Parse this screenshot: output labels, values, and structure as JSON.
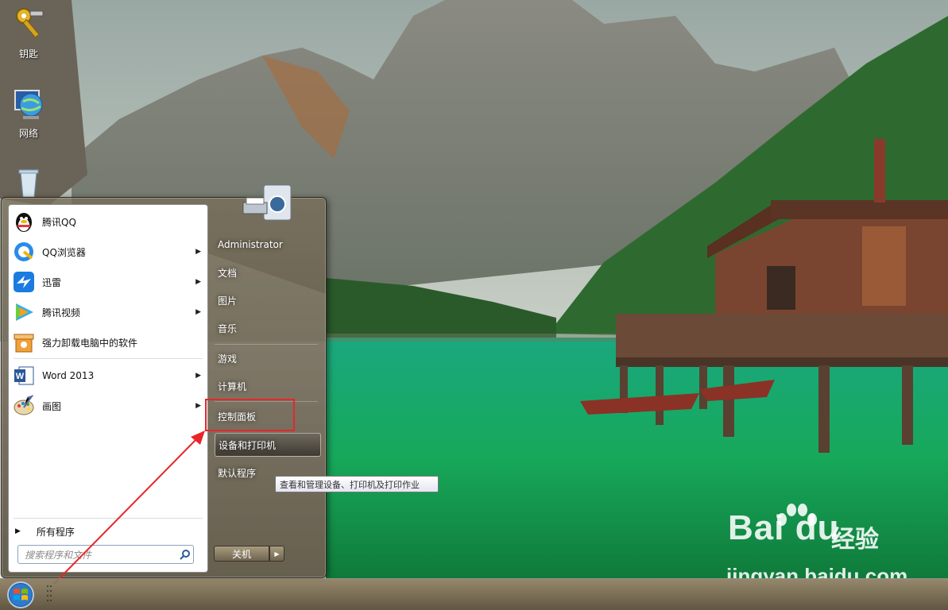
{
  "desktop": {
    "icons": [
      {
        "label": "钥匙",
        "icon": "key-icon"
      },
      {
        "label": "网络",
        "icon": "network-globe-icon"
      },
      {
        "label": "",
        "icon": "recycle-bin-icon"
      }
    ]
  },
  "start_menu": {
    "pinned_programs": [
      {
        "label": "腾讯QQ",
        "icon": "qq-penguin-icon",
        "has_submenu": false
      },
      {
        "label": "QQ浏览器",
        "icon": "qq-browser-icon",
        "has_submenu": true
      },
      {
        "label": "迅雷",
        "icon": "xunlei-bird-icon",
        "has_submenu": true
      },
      {
        "label": "腾讯视频",
        "icon": "tencent-video-icon",
        "has_submenu": true
      },
      {
        "label": "强力卸载电脑中的软件",
        "icon": "uninstaller-icon",
        "has_submenu": false
      },
      {
        "label": "Word 2013",
        "icon": "word-icon",
        "has_submenu": true
      },
      {
        "label": "画图",
        "icon": "paint-palette-icon",
        "has_submenu": true
      }
    ],
    "all_programs_label": "所有程序",
    "search_placeholder": "搜索程序和文件",
    "right_items": [
      {
        "label": "Administrator"
      },
      {
        "label": "文档"
      },
      {
        "label": "图片"
      },
      {
        "label": "音乐"
      },
      {
        "label": "游戏"
      },
      {
        "label": "计算机"
      },
      {
        "label": "控制面板"
      },
      {
        "label": "设备和打印机",
        "highlighted": true
      },
      {
        "label": "默认程序"
      }
    ],
    "shutdown_label": "关机",
    "user_picture": "printer-camera-icon"
  },
  "tooltip": "查看和管理设备、打印机及打印作业",
  "annotation": {
    "highlight_color": "#e8262a",
    "target": "控制面板"
  },
  "watermark": {
    "brand": "Bai  du",
    "sub": "经验",
    "url": "jingyan.baidu.com"
  },
  "taskbar": {
    "start_button": "windows-orb-icon"
  }
}
